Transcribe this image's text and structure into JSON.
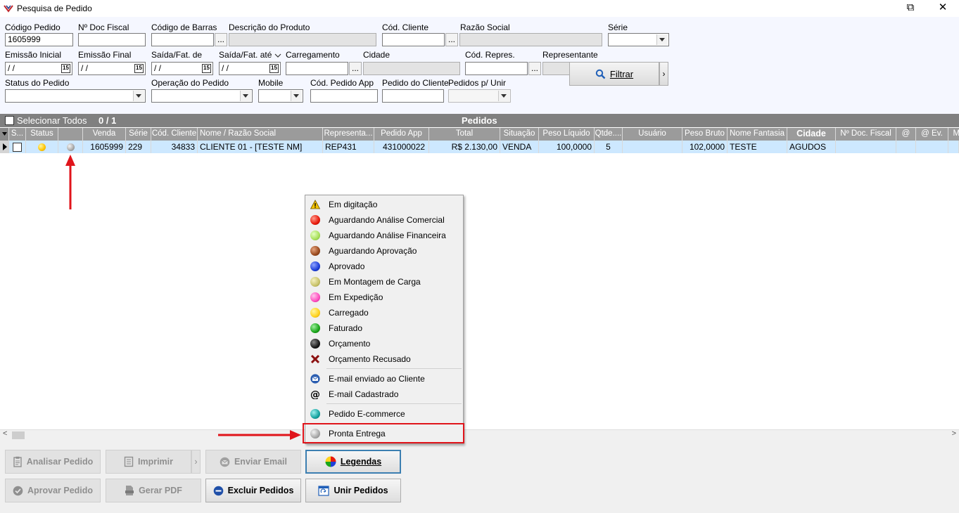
{
  "window": {
    "title": "Pesquisa de Pedido",
    "restore_glyph": "⧉",
    "close_glyph": "✕"
  },
  "filters": {
    "codigo_pedido": {
      "label": "Código Pedido",
      "value": "1605999"
    },
    "nr_doc_fiscal": {
      "label": "Nº Doc Fiscal",
      "value": ""
    },
    "codigo_barras": {
      "label": "Código de Barras",
      "value": ""
    },
    "descricao_produto": {
      "label": "Descrição do Produto",
      "value": ""
    },
    "cod_cliente": {
      "label": "Cód. Cliente",
      "value": ""
    },
    "razao_social": {
      "label": "Razão Social",
      "value": ""
    },
    "serie": {
      "label": "Série",
      "value": ""
    },
    "emissao_inicial": {
      "label": "Emissão Inicial",
      "value": " / /"
    },
    "emissao_final": {
      "label": "Emissão Final",
      "value": " / /"
    },
    "saida_fat_de": {
      "label": "Saída/Fat. de",
      "value": " / /"
    },
    "saida_fat_ate": {
      "label": "Saída/Fat. até",
      "value": " / /"
    },
    "carregamento": {
      "label": "Carregamento",
      "value": ""
    },
    "cidade": {
      "label": "Cidade",
      "value": ""
    },
    "cod_repres": {
      "label": "Cód. Repres.",
      "value": ""
    },
    "representante": {
      "label": "Representante",
      "value": ""
    },
    "status_pedido": {
      "label": "Status do Pedido",
      "value": ""
    },
    "operacao_pedido": {
      "label": "Operação do Pedido",
      "value": ""
    },
    "mobile": {
      "label": "Mobile",
      "value": ""
    },
    "cod_pedido_app": {
      "label": "Cód. Pedido App",
      "value": ""
    },
    "pedido_cliente": {
      "label": "Pedido do Cliente",
      "value": ""
    },
    "pedidos_unir": {
      "label": "Pedidos p/ Unir",
      "value": ""
    },
    "dots_label": "...",
    "filtrar_label": "Filtrar",
    "filtrar_arrow": "›",
    "cal_glyph": "15"
  },
  "grid": {
    "select_all_label": "Selecionar Todos",
    "count": "0 / 1",
    "title": "Pedidos",
    "columns": [
      "S...",
      "Status",
      "",
      "Venda",
      "Série",
      "Cód. Cliente",
      "Nome / Razão Social",
      "Representa...",
      "Pedido App",
      "Total",
      "Situação",
      "Peso Líquido",
      "Qtde....",
      "Usuário",
      "Peso Bruto",
      "Nome Fantasia",
      "Cidade",
      "Nº Doc. Fiscal",
      "@",
      "@ Ev.",
      "Mo"
    ],
    "row": {
      "venda": "1605999",
      "serie": "229",
      "cod_cliente": "34833",
      "nome": "CLIENTE 01 - [TESTE NM]",
      "representante": "REP431",
      "pedido_app": "431000022",
      "total": "R$ 2.130,00",
      "situacao": "VENDA",
      "peso_liquido": "100,0000",
      "qtde": "5",
      "usuario": "",
      "peso_bruto": "102,0000",
      "nome_fantasia": "TESTE",
      "cidade": "AGUDOS",
      "nr_doc_fiscal": "",
      "arroba": "",
      "arroba_ev": "",
      "mo": ""
    }
  },
  "legend_menu": {
    "items": [
      {
        "label": "Em digitação",
        "icon": "warning-icon",
        "color": "#f5c400"
      },
      {
        "label": "Aguardando Análise Comercial",
        "icon": "red-ball-icon",
        "color": "#e8190c"
      },
      {
        "label": "Aguardando Análise Financeira",
        "icon": "light-green-ball-icon",
        "color": "#a8e05a"
      },
      {
        "label": "Aguardando Aprovação",
        "icon": "brown-ball-icon",
        "color": "#9a4a1e"
      },
      {
        "label": "Aprovado",
        "icon": "blue-ball-icon",
        "color": "#1e3fd8"
      },
      {
        "label": "Em Montagem de Carga",
        "icon": "olive-ball-icon",
        "color": "#c9c36a"
      },
      {
        "label": "Em Expedição",
        "icon": "pink-ball-icon",
        "color": "#ff4fc0"
      },
      {
        "label": "Carregado",
        "icon": "yellow-ball-icon",
        "color": "#ffd21e"
      },
      {
        "label": "Faturado",
        "icon": "green-ball-icon",
        "color": "#1aa51a"
      },
      {
        "label": "Orçamento",
        "icon": "black-ball-icon",
        "color": "#1a1a1a"
      },
      {
        "label": "Orçamento Recusado",
        "icon": "red-x-icon",
        "color": "#8b1010"
      },
      {
        "label": "E-mail enviado ao Cliente",
        "icon": "email-sent-icon",
        "color": "#2a5db0"
      },
      {
        "label": "E-mail Cadastrado",
        "icon": "at-sign-icon",
        "color": "#000000"
      },
      {
        "label": "Pedido E-commerce",
        "icon": "teal-ball-icon",
        "color": "#15a3a0"
      },
      {
        "label": "Pronta Entrega",
        "icon": "gray-ball-icon",
        "color": "#a8a8a8"
      }
    ]
  },
  "buttons": {
    "analisar": "Analisar Pedido",
    "imprimir": "Imprimir",
    "imprimir_arrow": "›",
    "enviar_email": "Enviar Email",
    "legendas": "Legendas",
    "aprovar": "Aprovar Pedido",
    "gerar_pdf": "Gerar PDF",
    "excluir": "Excluir Pedidos",
    "unir": "Unir Pedidos"
  },
  "scrollbar": {
    "left_arrow": "<",
    "right_arrow": ">"
  },
  "colors": {
    "annotation_red": "#e0141b",
    "row_highlight": "#cde8ff",
    "header_gray": "#9b9b9b"
  }
}
